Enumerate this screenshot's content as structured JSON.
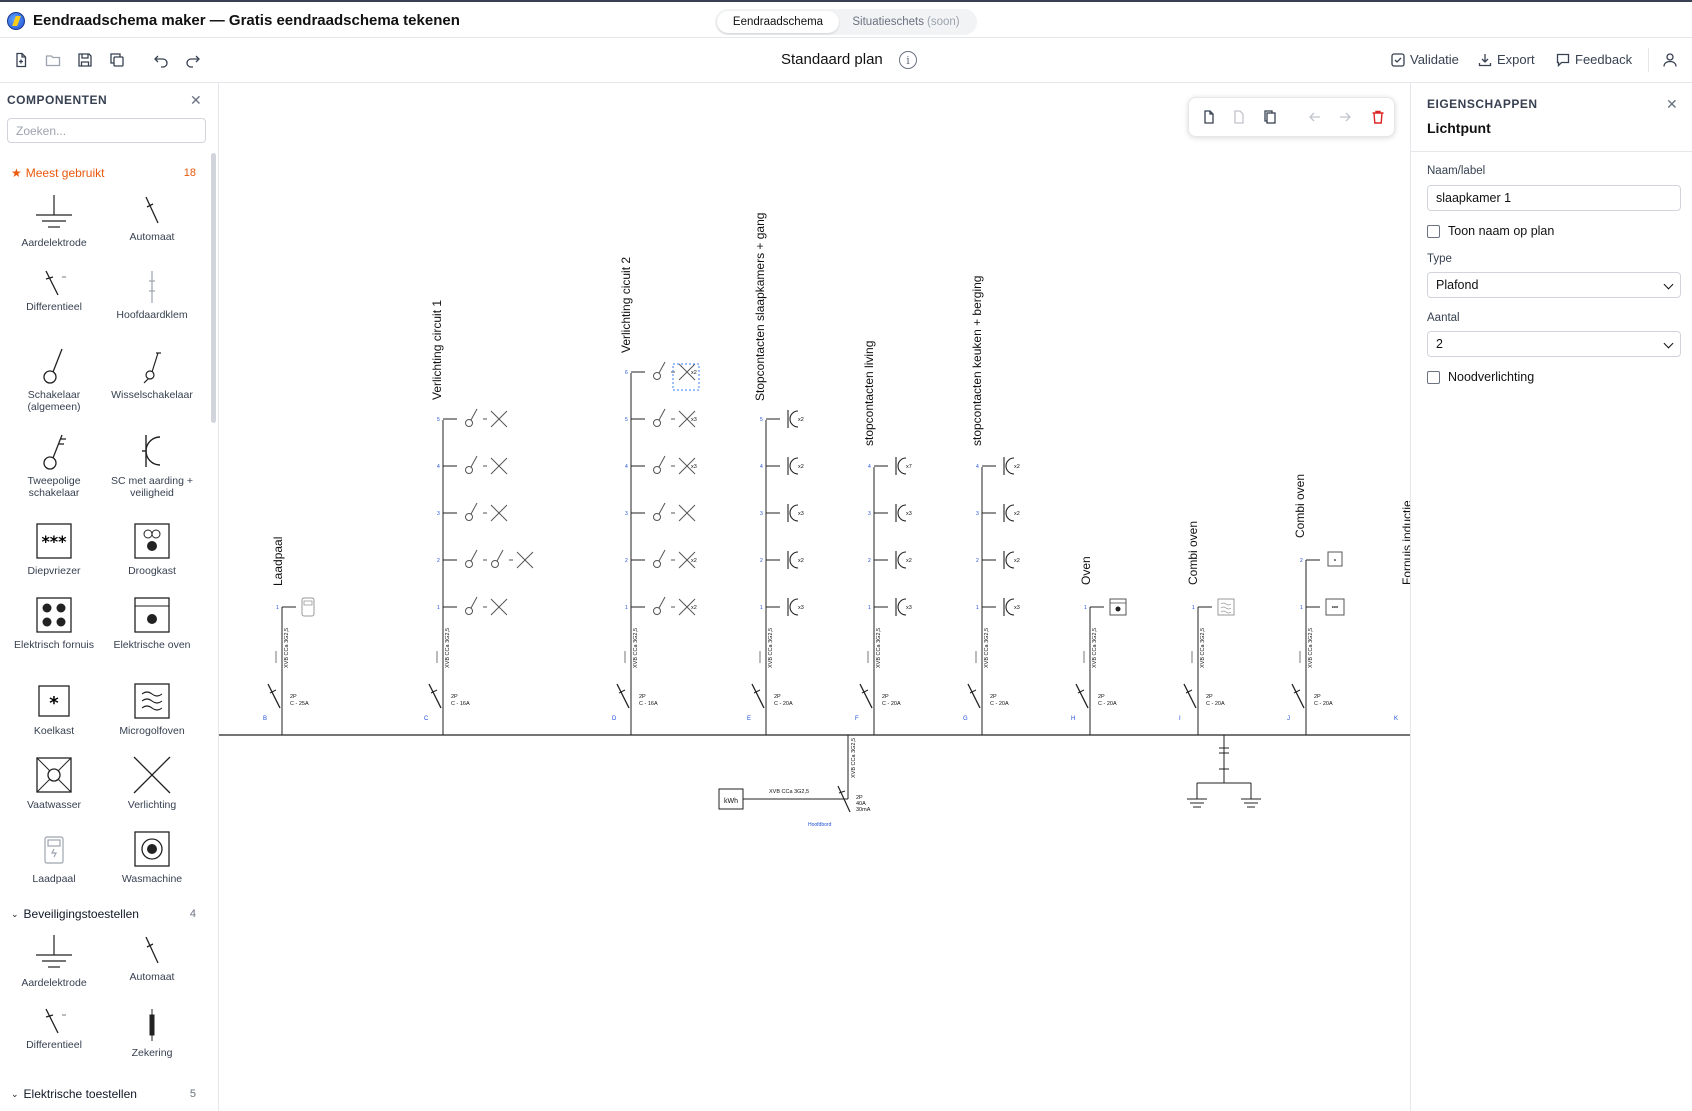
{
  "app": {
    "title": "Eendraadschema maker — Gratis eendraadschema tekenen",
    "logo_icon": "lightning-globe-icon"
  },
  "mode_toggle": {
    "active": "Eendraadschema",
    "inactive": "Situatieschets",
    "inactive_badge": "(soon)"
  },
  "toolbar": {
    "plan_title": "Standaard plan",
    "info_icon": "info-icon",
    "validate_label": "Validatie",
    "export_label": "Export",
    "feedback_label": "Feedback",
    "icons": [
      "new-file-icon",
      "open-folder-icon",
      "save-icon",
      "duplicate-icon",
      "undo-icon",
      "redo-icon",
      "user-icon"
    ]
  },
  "sidebar": {
    "title": "COMPONENTEN",
    "search_placeholder": "Zoeken...",
    "favorites": {
      "label": "Meest gebruikt",
      "count": "18",
      "icon": "star-icon",
      "items": [
        "Aardelektrode",
        "Automaat",
        "Differentieel",
        "Hoofdaardklem",
        "Schakelaar (algemeen)",
        "Wisselschakelaar",
        "Tweepolige schakelaar",
        "SC met aarding + veiligheid",
        "Diepvriezer",
        "Droogkast",
        "Elektrisch fornuis",
        "Elektrische oven",
        "Koelkast",
        "Microgolfoven",
        "Vaatwasser",
        "Verlichting",
        "Laadpaal",
        "Wasmachine"
      ]
    },
    "protection": {
      "label": "Beveiligingstoestellen",
      "count": "4",
      "items": [
        "Aardelektrode",
        "Automaat",
        "Differentieel",
        "Zekering"
      ]
    },
    "appliances": {
      "label": "Elektrische toestellen",
      "count": "5"
    }
  },
  "floating_toolbar": {
    "icons": [
      "copy-icon",
      "paste-icon",
      "duplicate-icon",
      "move-left-icon",
      "move-right-icon",
      "delete-icon"
    ]
  },
  "diagram": {
    "circuits": [
      {
        "letter": "B",
        "name": "Laadpaal",
        "breaker": [
          "2P",
          "C - 25A"
        ],
        "cable": "XVB CCa 3G2,5"
      },
      {
        "letter": "C",
        "name": "Verlichting circuit 1",
        "breaker": [
          "2P",
          "C - 16A"
        ],
        "cable": "XVB CCa 3G2,5"
      },
      {
        "letter": "D",
        "name": "Verlichting cicuit 2",
        "breaker": [
          "2P",
          "C - 16A"
        ],
        "cable": "XVB CCa 3G2,5"
      },
      {
        "letter": "E",
        "name": "Stopcontacten slaapkamers + gang",
        "breaker": [
          "2P",
          "C - 20A"
        ],
        "cable": "XVB CCa 3G2,5"
      },
      {
        "letter": "F",
        "name": "stopcontacten living",
        "breaker": [
          "2P",
          "C - 20A"
        ],
        "cable": "XVB CCa 3G2,5"
      },
      {
        "letter": "G",
        "name": "stopcontacten keuken + berging",
        "breaker": [
          "2P",
          "C - 20A"
        ],
        "cable": "XVB CCa 3G2,5"
      },
      {
        "letter": "H",
        "name": "Oven",
        "breaker": [
          "2P",
          "C - 20A"
        ],
        "cable": "XVB CCa 3G2,5"
      },
      {
        "letter": "I",
        "name": "Combi oven",
        "breaker": [
          "2P",
          "C - 20A"
        ],
        "cable": "XVB CCa 3G2,5"
      },
      {
        "letter": "J",
        "name": "Combi oven",
        "breaker": [
          "2P",
          "C - 20A"
        ],
        "cable": "XVB CCa 3G2,5"
      },
      {
        "letter": "K",
        "name": "Fornuis inductie",
        "breaker": [],
        "cable": ""
      }
    ],
    "main": {
      "meter": "kWh",
      "cable": "XVB CCa 3G2,5",
      "breaker": [
        "2P",
        "40A",
        "30mA"
      ],
      "label": "Hoofdbord",
      "feed_cable": "XVB CCa 3G2,5"
    }
  },
  "properties": {
    "title": "EIGENSCHAPPEN",
    "subtitle": "Lichtpunt",
    "name_label": "Naam/label",
    "name_value": "slaapkamer 1",
    "show_name_label": "Toon naam op plan",
    "type_label": "Type",
    "type_value": "Plafond",
    "count_label": "Aantal",
    "count_value": "2",
    "emergency_label": "Noodverlichting"
  }
}
